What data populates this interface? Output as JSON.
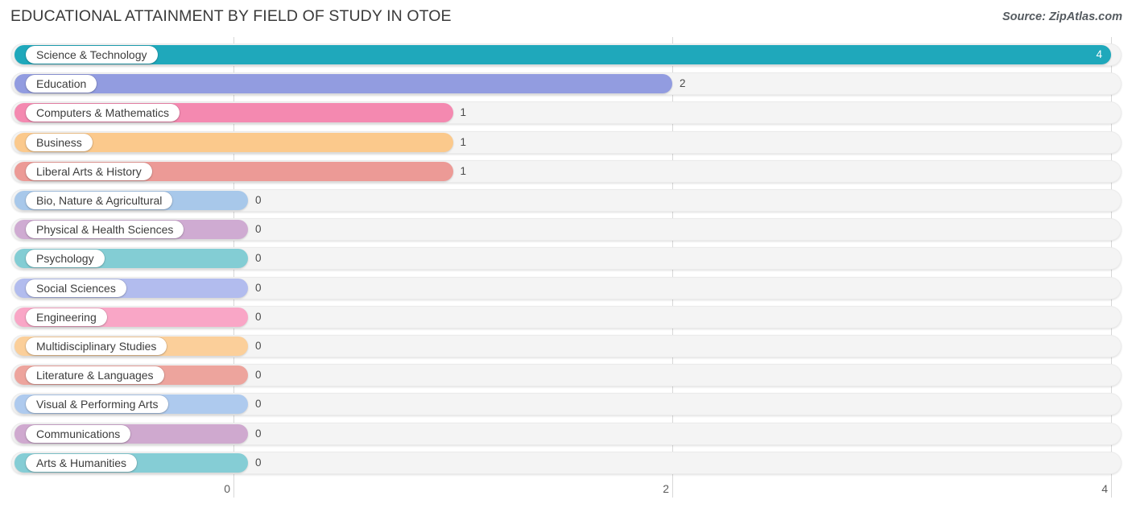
{
  "header": {
    "title": "EDUCATIONAL ATTAINMENT BY FIELD OF STUDY IN OTOE",
    "source": "Source: ZipAtlas.com"
  },
  "chart_data": {
    "type": "bar",
    "orientation": "horizontal",
    "title": "EDUCATIONAL ATTAINMENT BY FIELD OF STUDY IN OTOE",
    "xlabel": "",
    "ylabel": "",
    "xlim": [
      0,
      4
    ],
    "xticks": [
      "0",
      "2",
      "4"
    ],
    "xtick_values": [
      0,
      2,
      4
    ],
    "grid": true,
    "legend": false,
    "categories": [
      "Science & Technology",
      "Education",
      "Computers & Mathematics",
      "Business",
      "Liberal Arts & History",
      "Bio, Nature & Agricultural",
      "Physical & Health Sciences",
      "Psychology",
      "Social Sciences",
      "Engineering",
      "Multidisciplinary Studies",
      "Literature & Languages",
      "Visual & Performing Arts",
      "Communications",
      "Arts & Humanities"
    ],
    "values": [
      4,
      2,
      1,
      1,
      1,
      0,
      0,
      0,
      0,
      0,
      0,
      0,
      0,
      0,
      0
    ],
    "value_labels": [
      "4",
      "2",
      "1",
      "1",
      "1",
      "0",
      "0",
      "0",
      "0",
      "0",
      "0",
      "0",
      "0",
      "0",
      "0"
    ],
    "colors": [
      "#1fa8bb",
      "#929ce0",
      "#f489b0",
      "#fbc98c",
      "#ec9a96",
      "#a8c8ea",
      "#cfabd2",
      "#83cdd4",
      "#b2bcee",
      "#f9a6c6",
      "#fbcf9a",
      "#eda49d",
      "#aecaee",
      "#cfa9cf",
      "#85cdd5"
    ]
  },
  "colors": {
    "track": "#f4f4f4",
    "gridline": "#d8d8d8",
    "title_text": "#3a3a3a",
    "tick_text": "#5b5b5b",
    "value_text": "#4a4a4a",
    "value_text_inside": "#ffffff",
    "pill_background": "#ffffff",
    "background": "#ffffff"
  }
}
